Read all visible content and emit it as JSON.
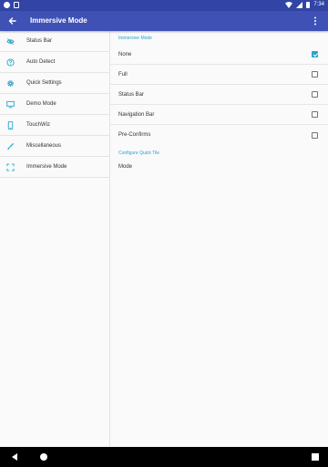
{
  "status_bar": {
    "time": "7:34",
    "icons": [
      "settings-icon",
      "sd-card-icon",
      "wifi-icon",
      "signal-icon",
      "battery-icon"
    ]
  },
  "app_bar": {
    "title": "Immersive Mode",
    "back_icon": "back-arrow-icon",
    "overflow_icon": "more-vert-icon",
    "color": "#3f51b5"
  },
  "sidebar": {
    "items": [
      {
        "label": "Status Bar",
        "icon": "eye-off-icon"
      },
      {
        "label": "Auto Detect",
        "icon": "help-circle-icon"
      },
      {
        "label": "Quick Settings",
        "icon": "gear-icon"
      },
      {
        "label": "Demo Mode",
        "icon": "monitor-icon"
      },
      {
        "label": "TouchWiz",
        "icon": "phone-icon"
      },
      {
        "label": "Miscellaneous",
        "icon": "brush-icon"
      },
      {
        "label": "Immersive Mode",
        "icon": "fullscreen-icon"
      }
    ]
  },
  "content": {
    "immersive_header": "Immersive Mode",
    "options": [
      {
        "label": "None",
        "checked": true
      },
      {
        "label": "Full",
        "checked": false
      },
      {
        "label": "Status Bar",
        "checked": false
      },
      {
        "label": "Navigation Bar",
        "checked": false
      },
      {
        "label": "Pre-Confirms",
        "checked": false
      }
    ],
    "quick_tile_header": "Configure Quick Tile",
    "mode_label": "Mode"
  },
  "nav_bar": {
    "icons": [
      "nav-back-icon",
      "nav-home-icon",
      "nav-recents-icon"
    ]
  },
  "colors": {
    "accent": "#26a3cc",
    "primary": "#3f51b5",
    "primary_dark": "#3245a6"
  }
}
